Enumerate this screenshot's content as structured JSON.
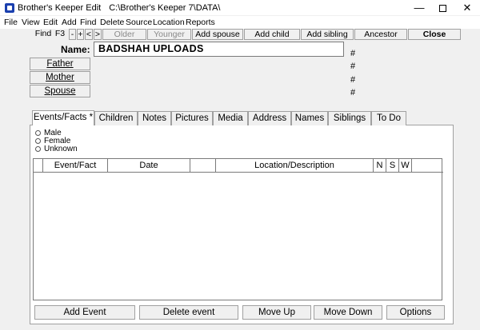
{
  "window": {
    "title": "Brother's Keeper Edit",
    "path": "C:\\Brother's Keeper 7\\DATA\\",
    "minimize": "—",
    "close": "✕"
  },
  "menu": [
    "File",
    "View",
    "Edit",
    "Add",
    "Find",
    "Delete",
    "Source",
    "Location",
    "Reports"
  ],
  "toolbar": {
    "find": "Find",
    "f3": "F3",
    "minus": "-",
    "plus": "+",
    "prev": "<",
    "next": ">",
    "older": "Older",
    "younger": "Younger",
    "add_spouse": "Add spouse",
    "add_child": "Add child",
    "add_sibling": "Add sibling",
    "ancestor": "Ancestor",
    "close": "Close"
  },
  "person": {
    "name_label": "Name:",
    "name_value": "BADSHAH UPLOADS",
    "hash": "#"
  },
  "relatives": {
    "father": "Father",
    "mother": "Mother",
    "spouse": "Spouse"
  },
  "tabs": [
    "Events/Facts *",
    "Children",
    "Notes",
    "Pictures",
    "Media",
    "Address",
    "Names",
    "Siblings",
    "To Do"
  ],
  "sex_options": [
    "Male",
    "Female",
    "Unknown"
  ],
  "grid_columns": [
    "Event/Fact",
    "Date",
    "Location/Description",
    "N",
    "S",
    "W"
  ],
  "buttons": {
    "add_event": "Add Event",
    "delete_event": "Delete event",
    "move_up": "Move Up",
    "move_down": "Move Down",
    "options": "Options"
  }
}
